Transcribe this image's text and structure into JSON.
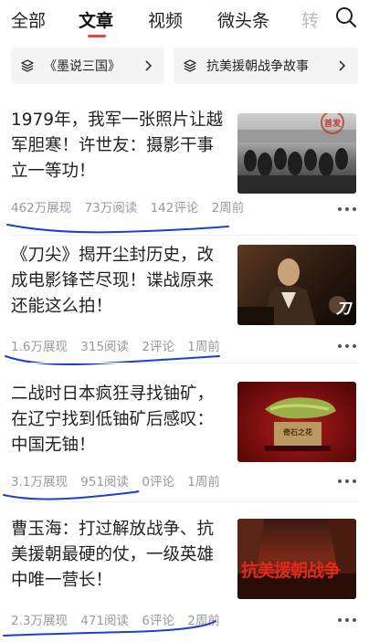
{
  "tabs": [
    {
      "label": "全部"
    },
    {
      "label": "文章"
    },
    {
      "label": "视频"
    },
    {
      "label": "微头条"
    },
    {
      "label": "转"
    }
  ],
  "active_tab_index": 1,
  "collections": [
    {
      "label": "《墨说三国》"
    },
    {
      "label": "抗美援朝战争故事"
    }
  ],
  "articles": [
    {
      "title_lines": [
        "1979年，我军一张照片让越",
        "军胆寒！许世友：摄影干事",
        "立一等功！"
      ],
      "impressions": "462万展现",
      "reads": "73万阅读",
      "comments": "142评论",
      "time": "2周前",
      "thumb_caption": "首发"
    },
    {
      "title_lines": [
        "《刀尖》揭开尘封历史，改",
        "成电影锋芒尽现！谍战原来",
        "还能这么拍！"
      ],
      "impressions": "1.6万展现",
      "reads": "315阅读",
      "comments": "2评论",
      "time": "1周前",
      "thumb_caption": "刀"
    },
    {
      "title_lines": [
        "二战时日本疯狂寻找铀矿，",
        "在辽宁找到低铀矿后感叹：",
        "中国无铀！"
      ],
      "impressions": "3.1万展现",
      "reads": "951阅读",
      "comments": "0评论",
      "time": "1周前",
      "thumb_caption": "奇石之花"
    },
    {
      "title_lines": [
        "曹玉海：打过解放战争、抗",
        "美援朝最硬的仗，一级英雄",
        "中唯一营长！"
      ],
      "impressions": "2.3万展现",
      "reads": "471阅读",
      "comments": "6评论",
      "time": "2周前",
      "thumb_caption": "抗美援朝战争"
    }
  ],
  "colors": {
    "accent": "#f04142",
    "annotation": "#1a3fd6",
    "meta": "#999999"
  },
  "icons": {
    "search": "search-icon",
    "collection": "stack-icon",
    "chevron": "chevron-right-icon",
    "more": "more-icon"
  }
}
